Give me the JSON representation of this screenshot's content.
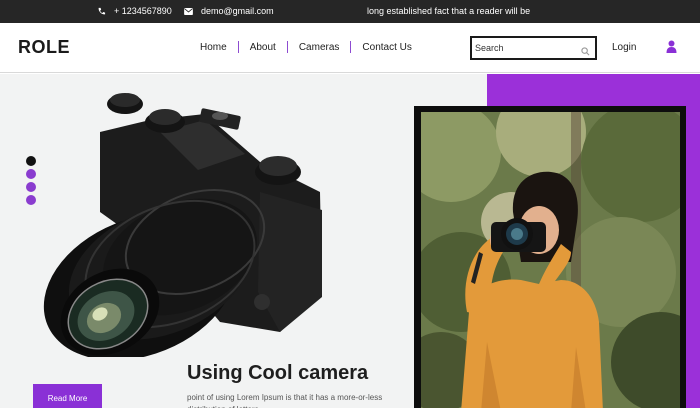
{
  "topbar": {
    "phone": "+ 1234567890",
    "email": "demo@gmail.com",
    "tagline": "long established fact that a reader will be"
  },
  "header": {
    "logo": "ROLE",
    "nav": [
      "Home",
      "About",
      "Cameras",
      "Contact Us"
    ],
    "search_placeholder": "Search",
    "login": "Login"
  },
  "hero": {
    "headline": "Using Cool camera",
    "description": "point of using Lorem Ipsum is that it has a more-or-less distribution of letters",
    "cta": "Read More",
    "slider_count": 4,
    "slider_active": 0
  },
  "colors": {
    "accent": "#8a30d6",
    "topbar": "#262626",
    "hero_bg": "#f2f3f3"
  },
  "icons": [
    "phone-icon",
    "mail-icon",
    "search-icon",
    "user-icon",
    "camera-image",
    "photographer-photo"
  ]
}
